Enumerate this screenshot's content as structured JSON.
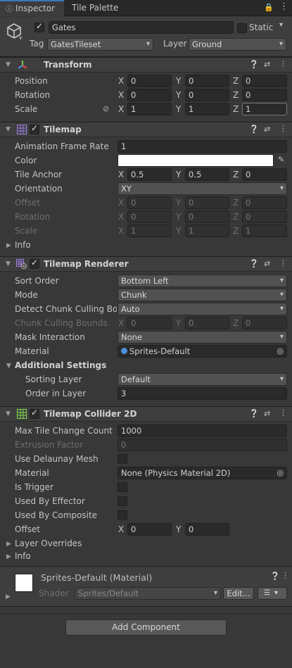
{
  "tabs": {
    "inspector": "Inspector",
    "tile_palette": "Tile Palette"
  },
  "object": {
    "name": "Gates",
    "static_label": "Static",
    "tag_label": "Tag",
    "tag_value": "GatesTileset",
    "layer_label": "Layer",
    "layer_value": "Ground"
  },
  "transform": {
    "title": "Transform",
    "position": {
      "label": "Position",
      "x": "0",
      "y": "0",
      "z": "0"
    },
    "rotation": {
      "label": "Rotation",
      "x": "0",
      "y": "0",
      "z": "0"
    },
    "scale": {
      "label": "Scale",
      "x": "1",
      "y": "1",
      "z": "1"
    }
  },
  "tilemap": {
    "title": "Tilemap",
    "anim_rate_label": "Animation Frame Rate",
    "anim_rate": "1",
    "color_label": "Color",
    "anchor_label": "Tile Anchor",
    "anchor_x": "0.5",
    "anchor_y": "0.5",
    "anchor_z": "0",
    "orientation_label": "Orientation",
    "orientation": "XY",
    "offset_label": "Offset",
    "offset_x": "0",
    "offset_y": "0",
    "offset_z": "0",
    "rotation_label": "Rotation",
    "rot_x": "0",
    "rot_y": "0",
    "rot_z": "0",
    "scale_label": "Scale",
    "scale_x": "1",
    "scale_y": "1",
    "scale_z": "1",
    "info_label": "Info"
  },
  "renderer": {
    "title": "Tilemap Renderer",
    "sort_order_label": "Sort Order",
    "sort_order": "Bottom Left",
    "mode_label": "Mode",
    "mode": "Chunk",
    "culling_label": "Detect Chunk Culling Bou",
    "culling": "Auto",
    "bounds_label": "Chunk Culling Bounds",
    "bounds_x": "0",
    "bounds_y": "0",
    "bounds_z": "0",
    "mask_label": "Mask Interaction",
    "mask": "None",
    "material_label": "Material",
    "material": "Sprites-Default",
    "additional_label": "Additional Settings",
    "sorting_layer_label": "Sorting Layer",
    "sorting_layer": "Default",
    "order_label": "Order in Layer",
    "order": "3"
  },
  "collider": {
    "title": "Tilemap Collider 2D",
    "max_tile_label": "Max Tile Change Count",
    "max_tile": "1000",
    "extrusion_label": "Extrusion Factor",
    "extrusion": "0",
    "delaunay_label": "Use Delaunay Mesh",
    "material_label": "Material",
    "material": "None (Physics Material 2D)",
    "trigger_label": "Is Trigger",
    "effector_label": "Used By Effector",
    "composite_label": "Used By Composite",
    "offset_label": "Offset",
    "offset_x": "0",
    "offset_y": "0",
    "layer_overrides_label": "Layer Overrides",
    "info_label": "Info"
  },
  "material_preview": {
    "name": "Sprites-Default (Material)",
    "shader_label": "Shader",
    "shader": "Sprites/Default",
    "edit_label": "Edit..."
  },
  "add_component_label": "Add Component",
  "axes": {
    "x": "X",
    "y": "Y",
    "z": "Z"
  },
  "colors": {
    "accent": "#3a79bb",
    "panel": "#383838",
    "header": "#3e3e3e",
    "field": "#2a2a2a"
  }
}
